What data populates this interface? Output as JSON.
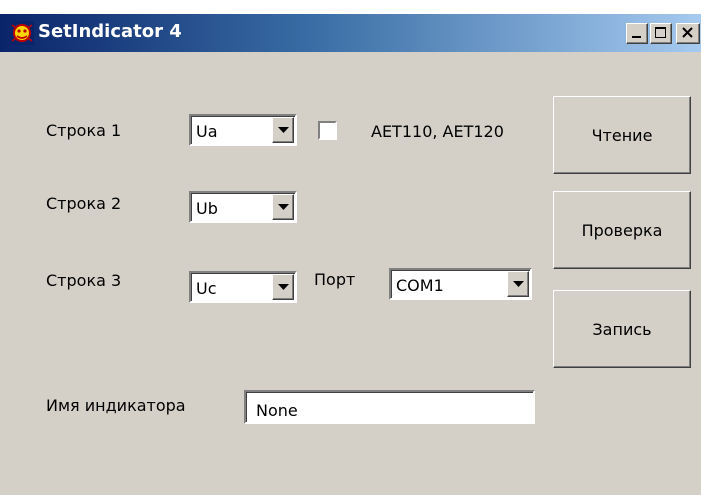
{
  "window": {
    "title": "SetIndicator 4"
  },
  "titlebar_buttons": {
    "minimize_icon": "minimize-icon",
    "maximize_icon": "maximize-icon",
    "close_icon": "close-icon"
  },
  "rows": [
    {
      "label": "Строка 1",
      "selected": "Ua"
    },
    {
      "label": "Строка 2",
      "selected": "Ub"
    },
    {
      "label": "Строка 3",
      "selected": "Uc"
    }
  ],
  "checkbox": {
    "label": "AET110, AET120",
    "checked": false
  },
  "port": {
    "label": "Порт",
    "selected": "COM1"
  },
  "indicator_name": {
    "label": "Имя индикатора",
    "value": "None"
  },
  "buttons": {
    "read": "Чтение",
    "check": "Проверка",
    "write": "Запись"
  },
  "colors": {
    "window_face": "#d4d0c8",
    "titlebar_start": "#0a246a",
    "titlebar_end": "#a6caf0"
  }
}
